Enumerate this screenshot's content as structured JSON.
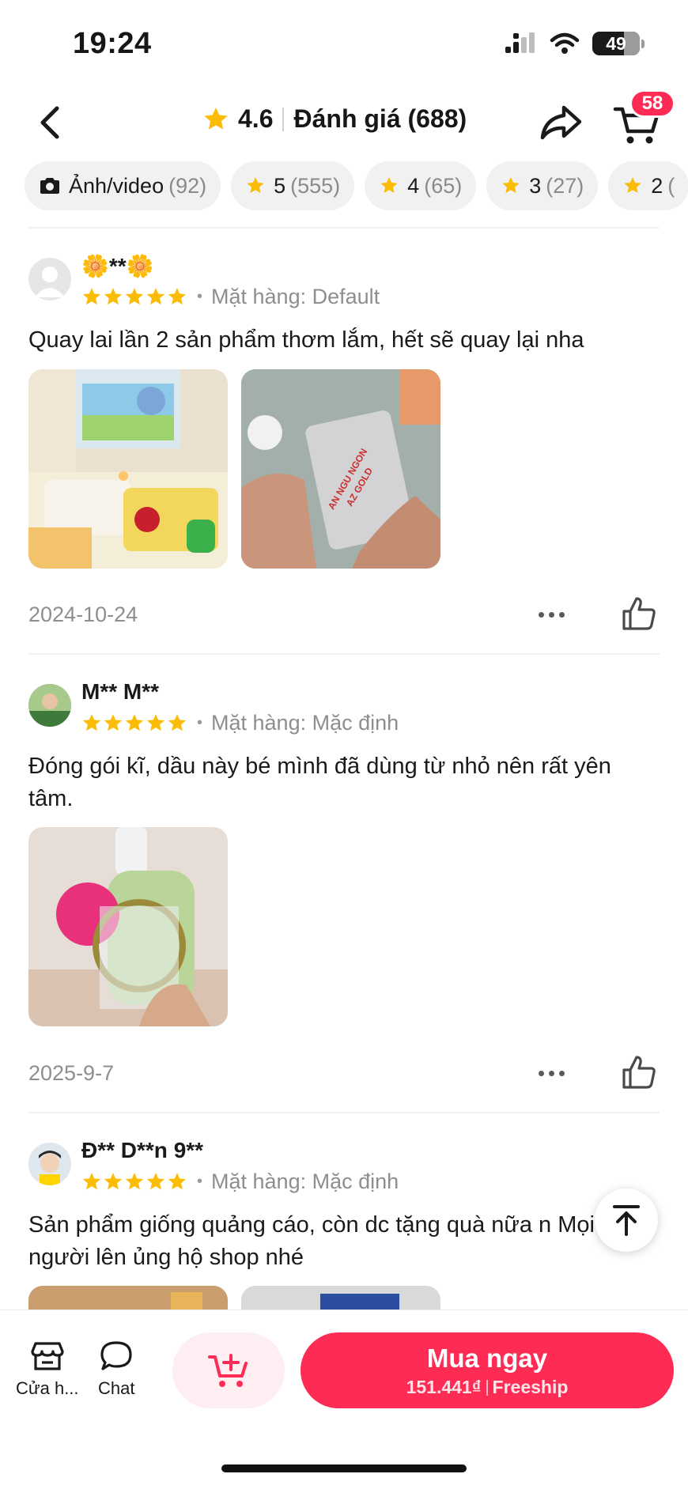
{
  "status_bar": {
    "time": "19:24",
    "battery": "49"
  },
  "header": {
    "rating": "4.6",
    "title": "Đánh giá (688)",
    "cart_count": "58",
    "star_color": "#fbbc05",
    "accent_color": "#fe2c55"
  },
  "filters": [
    {
      "label": "Ảnh/video",
      "count": "(92)",
      "icon": "camera-icon"
    },
    {
      "label": "5",
      "count": "(555)",
      "icon": "star-icon"
    },
    {
      "label": "4",
      "count": "(65)",
      "icon": "star-icon"
    },
    {
      "label": "3",
      "count": "(27)",
      "icon": "star-icon"
    },
    {
      "label": "2",
      "count": "(",
      "icon": "star-icon"
    }
  ],
  "reviews": [
    {
      "user": "🌼**🌼",
      "stars": 5,
      "variant": "Mặt hàng: Default",
      "text": "Quay lai lần 2 sản phẩm thơm lắm, hết sẽ quay lại nha",
      "date": "2024-10-24",
      "photos": [
        "kids-room-photo",
        "pill-blister-photo"
      ]
    },
    {
      "user": "M** M**",
      "stars": 5,
      "variant": "Mặt hàng: Mặc định",
      "text": "Đóng gói kĩ, dầu này bé mình đã dùng từ nhỏ nên rất yên tâm.",
      "date": "2025-9-7",
      "photos": [
        "oil-bottle-photo"
      ]
    },
    {
      "user": "Đ** D**n 9**",
      "stars": 5,
      "variant": "Mặt hàng: Mặc định",
      "text": "Sản phẩm giống quảng cáo, còn dc tặng quà nữa n Mọi người lên ủng hộ shop nhé",
      "photos": [
        "package-photo",
        "gift-photo"
      ]
    }
  ],
  "bottom_bar": {
    "shop_label": "Cửa h...",
    "chat_label": "Chat",
    "buy_label": "Mua ngay",
    "price": "151.441₫",
    "shipping": "Freeship"
  }
}
